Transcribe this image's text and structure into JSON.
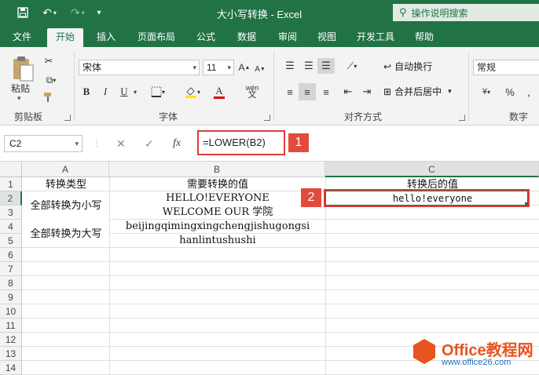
{
  "window": {
    "title": "大小写转换 - Excel",
    "tell_me": "操作说明搜索"
  },
  "tabs": [
    "文件",
    "开始",
    "插入",
    "页面布局",
    "公式",
    "数据",
    "审阅",
    "视图",
    "开发工具",
    "帮助"
  ],
  "active_tab": "开始",
  "ribbon": {
    "clipboard": {
      "paste_label": "粘贴",
      "group_label": "剪贴板"
    },
    "font": {
      "font_name": "宋体",
      "font_size": "11",
      "group_label": "字体",
      "bold": "B",
      "italic": "I",
      "underline": "U",
      "font_color": "A"
    },
    "alignment": {
      "wrap_text": "自动换行",
      "merge_center": "合并后居中",
      "group_label": "对齐方式"
    },
    "number": {
      "format": "常规",
      "group_label": "数字",
      "percent": "%"
    }
  },
  "formula_bar": {
    "name_box": "C2",
    "fx": "fx",
    "formula": "=LOWER(B2)"
  },
  "annotations": {
    "badge1": "1",
    "badge2": "2"
  },
  "columns": [
    "A",
    "B",
    "C"
  ],
  "rows": [
    "1",
    "2",
    "3",
    "4",
    "5",
    "6",
    "7",
    "8",
    "9",
    "10",
    "11",
    "12",
    "13",
    "14"
  ],
  "cells": {
    "A1": "转换类型",
    "B1": "需要转换的值",
    "C1": "转换后的值",
    "A2": "全部转换为小写",
    "B2": "HELLO!EVERYONE",
    "C2": "hello!everyone",
    "B3": "WELCOME OUR 学院",
    "A4": "全部转换为大写",
    "B4": "beijingqimingxingchengjishugongsi",
    "B5": "hanlintushushi"
  },
  "watermark": {
    "brand": "Office教程网",
    "url": "www.office26.com"
  },
  "colors": {
    "excel_green": "#217346",
    "highlight_red": "#e03b3b"
  }
}
